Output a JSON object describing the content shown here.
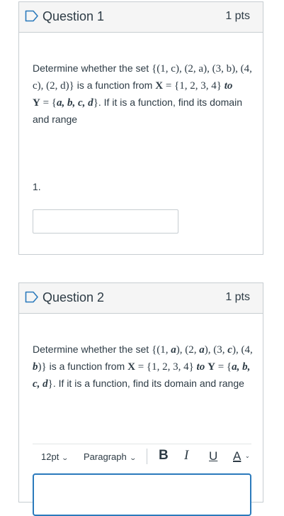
{
  "questions": [
    {
      "title": "Question 1",
      "points": "1 pts",
      "text": {
        "p1": "Determine whether the set ",
        "set": "{(1, c), (2, a), (3, b), (4, c), (2, d)}",
        "p2": " is a function from ",
        "X": "X",
        "xset": " = {1, 2, 3, 4} ",
        "to": "to",
        "Y": "Y",
        "yeq": " = {",
        "yvals": "a, b, c, d",
        "yclose": "}",
        "p3": ". If it is a function, find its domain and range"
      },
      "answer_label": "1."
    },
    {
      "title": "Question 2",
      "points": "1 pts",
      "text": {
        "p1": "Determine whether the set ",
        "set_a": "{(1, ",
        "a": "a",
        "set_b": "), (2, ",
        "a2": "a",
        "set_c": "), (3, ",
        "c": "c",
        "set_d": "), (4, ",
        "b": "b",
        "set_e": ")}",
        "p2": " is a function from ",
        "X": "X",
        "xset": " = {1, 2, 3, 4} ",
        "to": "to",
        "Y": "Y",
        "yeq": " = {",
        "yvals": "a, b, c, d",
        "yclose": "}",
        "p3": ". If it is a function, find its domain and range"
      },
      "toolbar": {
        "font_size": "12pt",
        "paragraph": "Paragraph",
        "bold": "B",
        "italic": "I",
        "underline": "U",
        "color": "A"
      }
    }
  ],
  "icons": {
    "flag": "flag-icon",
    "chevron": "chevron-down-icon"
  },
  "colors": {
    "header_bg": "#f5f5f5",
    "border": "#c7cdd1",
    "text": "#2d3b45",
    "focus": "#2b7abc",
    "flag": "#2b7abc"
  }
}
